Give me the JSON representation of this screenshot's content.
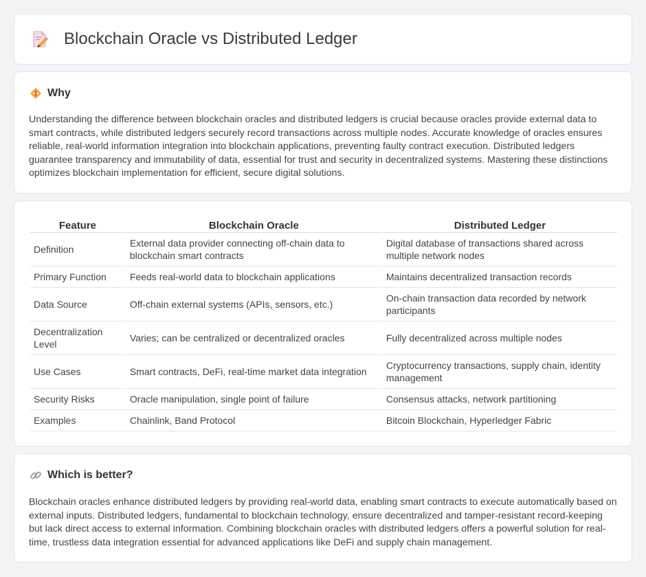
{
  "header": {
    "title": "Blockchain Oracle vs Distributed Ledger",
    "icon": "document-pen-icon"
  },
  "why": {
    "title": "Why",
    "icon": "diamond-badge-icon",
    "text": "Understanding the difference between blockchain oracles and distributed ledgers is crucial because oracles provide external data to smart contracts, while distributed ledgers securely record transactions across multiple nodes. Accurate knowledge of oracles ensures reliable, real-world information integration into blockchain applications, preventing faulty contract execution. Distributed ledgers guarantee transparency and immutability of data, essential for trust and security in decentralized systems. Mastering these distinctions optimizes blockchain implementation for efficient, secure digital solutions."
  },
  "table": {
    "headers": [
      "Feature",
      "Blockchain Oracle",
      "Distributed Ledger"
    ],
    "rows": [
      [
        "Definition",
        "External data provider connecting off-chain data to blockchain smart contracts",
        "Digital database of transactions shared across multiple network nodes"
      ],
      [
        "Primary Function",
        "Feeds real-world data to blockchain applications",
        "Maintains decentralized transaction records"
      ],
      [
        "Data Source",
        "Off-chain external systems (APIs, sensors, etc.)",
        "On-chain transaction data recorded by network participants"
      ],
      [
        "Decentralization Level",
        "Varies; can be centralized or decentralized oracles",
        "Fully decentralized across multiple nodes"
      ],
      [
        "Use Cases",
        "Smart contracts, DeFi, real-time market data integration",
        "Cryptocurrency transactions, supply chain, identity management"
      ],
      [
        "Security Risks",
        "Oracle manipulation, single point of failure",
        "Consensus attacks, network partitioning"
      ],
      [
        "Examples",
        "Chainlink, Band Protocol",
        "Bitcoin Blockchain, Hyperledger Fabric"
      ]
    ]
  },
  "better": {
    "title": "Which is better?",
    "icon": "link-icon",
    "text": "Blockchain oracles enhance distributed ledgers by providing real-world data, enabling smart contracts to execute automatically based on external inputs. Distributed ledgers, fundamental to blockchain technology, ensure decentralized and tamper-resistant record-keeping but lack direct access to external information. Combining blockchain oracles with distributed ledgers offers a powerful solution for real-time, trustless data integration essential for advanced applications like DeFi and supply chain management."
  },
  "colors": {
    "background": "#f3f4f6",
    "card": "#ffffff",
    "accent_orange": "#f2a33a",
    "accent_pink": "#e87d8a"
  }
}
